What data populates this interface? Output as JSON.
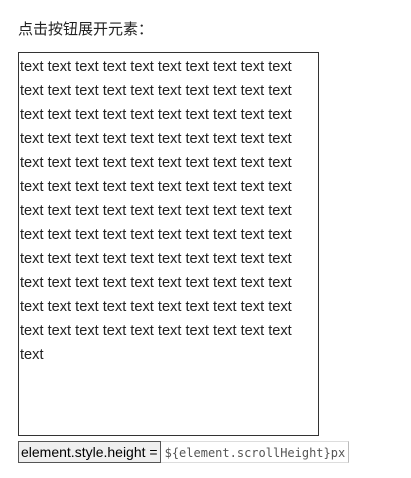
{
  "instruction": "点击按钮展开元素：",
  "content": {
    "text": "text text text text text text text text text text text text text text text text text text text text text text text text text text text text text text text text text text text text text text text text text text text text text text text text text text text text text text text text text text text text text text text text text text text text text text text text text text text text text text text text text text text text text text text text text text text text text text text text text text text text text text text text text text text text text text text text text text text text text text text text text"
  },
  "button": {
    "label": "element.style.height = ",
    "code_suffix": "${element.scrollHeight}px"
  }
}
